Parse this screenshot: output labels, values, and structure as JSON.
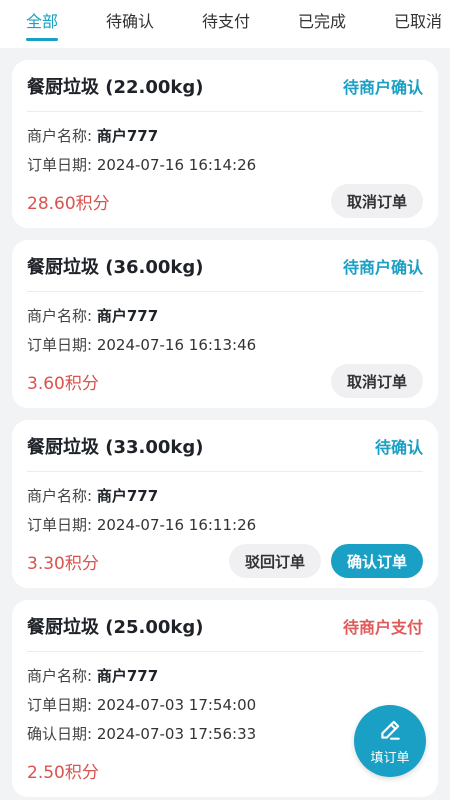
{
  "tabs": [
    {
      "label": "全部",
      "active": true
    },
    {
      "label": "待确认",
      "active": false
    },
    {
      "label": "待支付",
      "active": false
    },
    {
      "label": "已完成",
      "active": false
    },
    {
      "label": "已取消",
      "active": false
    }
  ],
  "labels": {
    "merchant": "商户名称:",
    "order_date": "订单日期:",
    "confirm_date": "确认日期:"
  },
  "orders": [
    {
      "title": "餐厨垃圾 (22.00kg)",
      "status": "待商户确认",
      "merchant": "商户777",
      "order_date": "2024-07-16 16:14:26",
      "points": "28.60积分",
      "buttons": [
        "取消订单"
      ]
    },
    {
      "title": "餐厨垃圾 (36.00kg)",
      "status": "待商户确认",
      "merchant": "商户777",
      "order_date": "2024-07-16 16:13:46",
      "points": "3.60积分",
      "buttons": [
        "取消订单"
      ]
    },
    {
      "title": "餐厨垃圾 (33.00kg)",
      "status": "待确认",
      "merchant": "商户777",
      "order_date": "2024-07-16 16:11:26",
      "points": "3.30积分",
      "buttons": [
        "驳回订单",
        "确认订单"
      ]
    },
    {
      "title": "餐厨垃圾 (25.00kg)",
      "status": "待商户支付",
      "merchant": "商户777",
      "order_date": "2024-07-03 17:54:00",
      "confirm_date": "2024-07-03 17:56:33",
      "points": "2.50积分"
    }
  ],
  "fab": {
    "label": "填订单",
    "icon": "pencil-icon"
  },
  "colors": {
    "accent": "#1aa0c4",
    "danger": "#e05a5a",
    "background": "#f2f3f5"
  }
}
